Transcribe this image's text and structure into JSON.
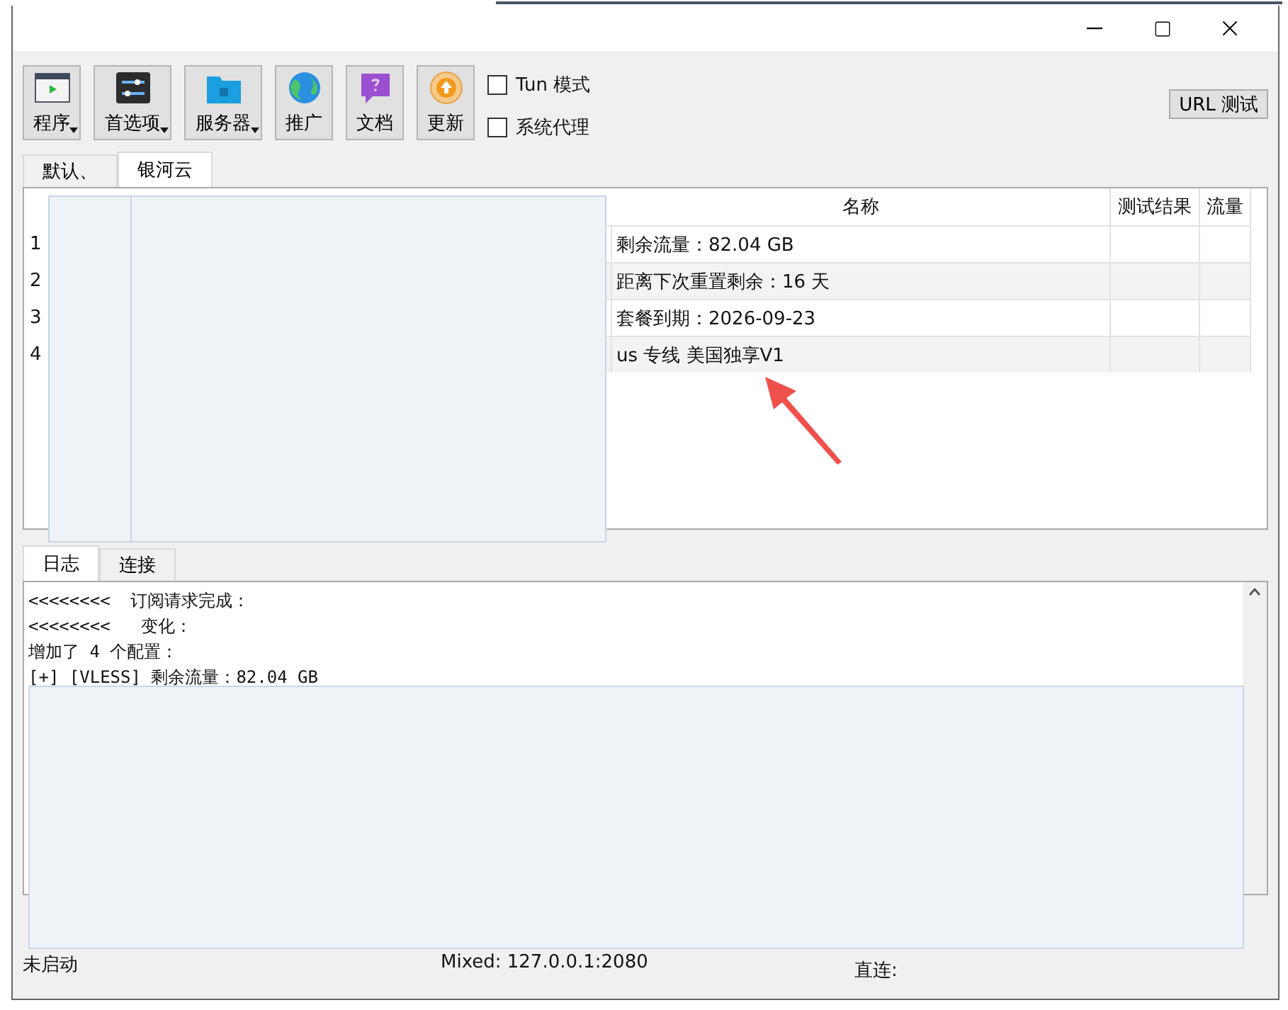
{
  "toolbar": {
    "buttons": [
      {
        "label": "程序",
        "has_menu": true
      },
      {
        "label": "首选项",
        "has_menu": true
      },
      {
        "label": "服务器",
        "has_menu": true
      },
      {
        "label": "推广",
        "has_menu": false
      },
      {
        "label": "文档",
        "has_menu": false
      },
      {
        "label": "更新",
        "has_menu": false
      }
    ],
    "checkboxes": [
      {
        "label": "Tun 模式",
        "checked": false
      },
      {
        "label": "系统代理",
        "checked": false
      }
    ],
    "url_test_button": "URL 测试"
  },
  "group_tabs": [
    {
      "label": "默认、",
      "selected": false
    },
    {
      "label": "银河云",
      "selected": true
    }
  ],
  "table": {
    "columns": [
      "名称",
      "测试结果",
      "流量"
    ],
    "rows": [
      {
        "index": "1",
        "name": "剩余流量：82.04 GB"
      },
      {
        "index": "2",
        "name": "距离下次重置剩余：16 天"
      },
      {
        "index": "3",
        "name": "套餐到期：2026-09-23"
      },
      {
        "index": "4",
        "name": "us 专线 美国独享V1"
      }
    ]
  },
  "bottom_tabs": [
    {
      "label": "日志",
      "selected": true
    },
    {
      "label": "连接",
      "selected": false
    }
  ],
  "log_lines": [
    "<<<<<<<<  订阅请求完成：",
    "<<<<<<<<   变化：",
    "增加了 4 个配置：",
    "[+] [VLESS] 剩余流量：82.04 GB"
  ],
  "status_bar": {
    "state": "未启动",
    "mixed": "Mixed: 127.0.0.1:2080",
    "direct": "直连:"
  }
}
